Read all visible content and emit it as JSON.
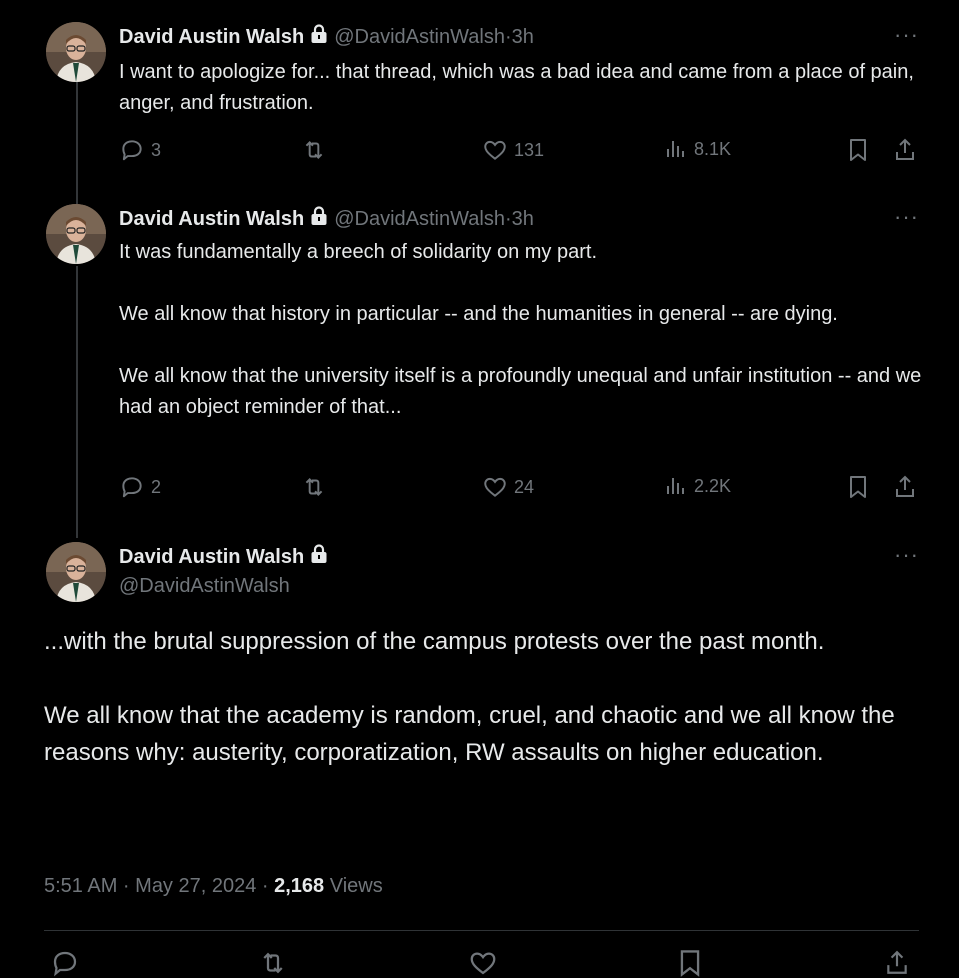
{
  "tweets": [
    {
      "name": "David Austin Walsh",
      "handle": "@DavidAstinWalsh",
      "time": "3h",
      "text": "I want to apologize for... that thread, which was a bad idea and came from a place of pain, anger, and frustration.",
      "replies": "3",
      "likes": "131",
      "views": "8.1K"
    },
    {
      "name": "David Austin Walsh",
      "handle": "@DavidAstinWalsh",
      "time": "3h",
      "text": "It was fundamentally a breech of solidarity on my part.\n\nWe all know that history in particular -- and the humanities in general -- are dying.\n\nWe all know that the university itself is a profoundly unequal and unfair institution -- and we had an object reminder of that...",
      "replies": "2",
      "likes": "24",
      "views": "2.2K"
    }
  ],
  "main": {
    "name": "David Austin Walsh",
    "handle": "@DavidAstinWalsh",
    "text": "...with the brutal suppression of the campus protests over the past month.\n\nWe all know that the academy is random, cruel, and chaotic and we all know the reasons why: austerity, corporatization, RW assaults on higher education.",
    "timestamp": "5:51 AM · May 27, 2024 · ",
    "views_count": "2,168",
    "views_label": " Views"
  },
  "sep": " · ",
  "more": "···",
  "icons": {
    "lock": "lock-icon",
    "reply": "reply-icon",
    "retweet": "retweet-icon",
    "like": "heart-icon",
    "views": "views-icon",
    "bookmark": "bookmark-icon",
    "share": "share-icon"
  },
  "colors": {
    "background": "#000000",
    "text": "#e7e9ea",
    "muted": "#71767b",
    "line": "#333639"
  }
}
